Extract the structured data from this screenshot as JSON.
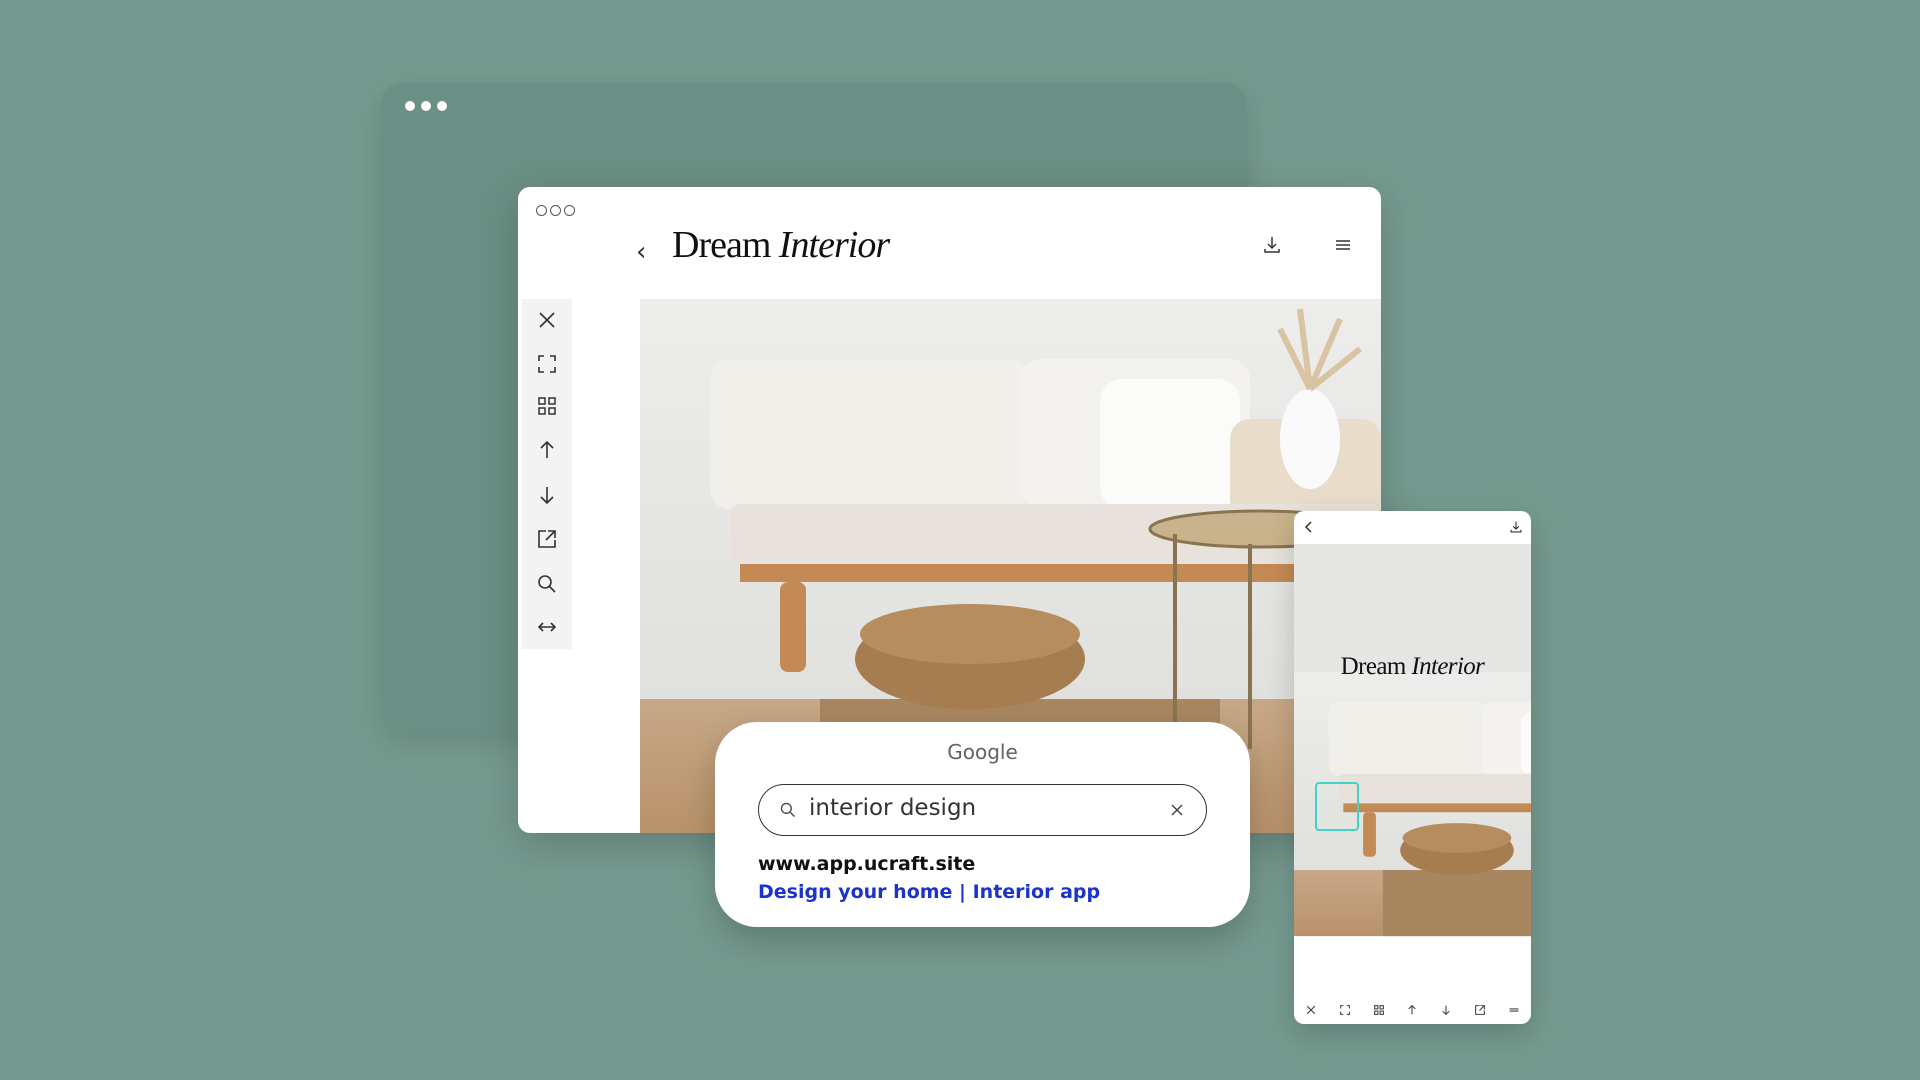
{
  "app": {
    "title_regular": "Dream",
    "title_italic": "Interior"
  },
  "header": {
    "back_icon": "chevron-left-icon",
    "download_icon": "download-icon",
    "menu_icon": "menu-icon"
  },
  "sidebar": {
    "items": [
      "close-icon",
      "fullscreen-icon",
      "grid-icon",
      "arrow-up-icon",
      "arrow-down-icon",
      "external-link-icon",
      "search-icon",
      "resize-horizontal-icon"
    ]
  },
  "search_card": {
    "engine": "Google",
    "query": "interior design",
    "result_url": "www.app.ucraft.site",
    "result_title": "Design your home | Interior app"
  },
  "phone": {
    "title_regular": "Dream",
    "title_italic": "Interior"
  },
  "colors": {
    "background": "#759a8f",
    "link": "#1a33cc",
    "highlight": "#3fd4c6"
  }
}
